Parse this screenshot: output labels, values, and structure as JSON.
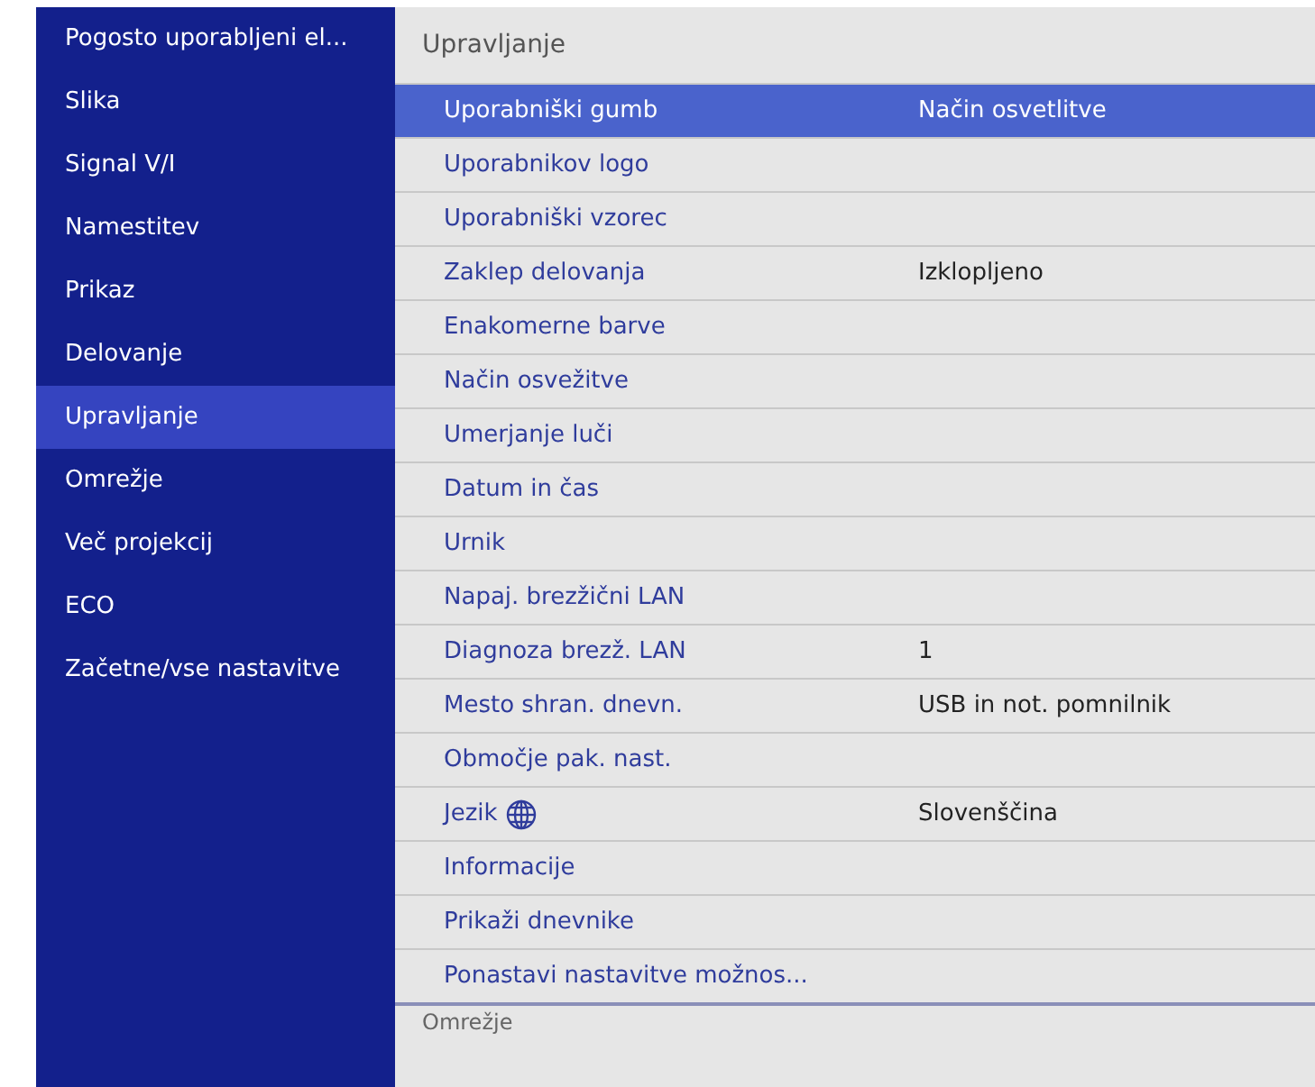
{
  "sidebar": {
    "items": [
      {
        "label": "Pogosto uporabljeni el...",
        "selected": false
      },
      {
        "label": "Slika",
        "selected": false
      },
      {
        "label": "Signal V/I",
        "selected": false
      },
      {
        "label": "Namestitev",
        "selected": false
      },
      {
        "label": "Prikaz",
        "selected": false
      },
      {
        "label": "Delovanje",
        "selected": false
      },
      {
        "label": "Upravljanje",
        "selected": true
      },
      {
        "label": "Omrežje",
        "selected": false
      },
      {
        "label": "Več projekcij",
        "selected": false
      },
      {
        "label": "ECO",
        "selected": false
      },
      {
        "label": "Začetne/vse nastavitve",
        "selected": false
      }
    ]
  },
  "panel": {
    "title": "Upravljanje",
    "rows": [
      {
        "label": "Uporabniški gumb",
        "value": "Način osvetlitve",
        "selected": true
      },
      {
        "label": "Uporabnikov logo",
        "selected": false
      },
      {
        "label": "Uporabniški vzorec",
        "selected": false
      },
      {
        "label": "Zaklep delovanja",
        "value": "Izklopljeno",
        "selected": false
      },
      {
        "label": "Enakomerne barve",
        "selected": false
      },
      {
        "label": "Način osvežitve",
        "selected": false
      },
      {
        "label": "Umerjanje luči",
        "selected": false
      },
      {
        "label": "Datum in čas",
        "selected": false
      },
      {
        "label": "Urnik",
        "selected": false
      },
      {
        "label": "Napaj. brezžični LAN",
        "selected": false
      },
      {
        "label": "Diagnoza brezž. LAN",
        "value": "1",
        "selected": false
      },
      {
        "label": "Mesto shran. dnevn.",
        "value": "USB in not. pomnilnik",
        "selected": false
      },
      {
        "label": "Območje pak. nast.",
        "selected": false
      },
      {
        "label": "Jezik",
        "value": "Slovenščina",
        "globe_icon": true,
        "selected": false
      },
      {
        "label": "Informacije",
        "selected": false
      },
      {
        "label": "Prikaži dnevnike",
        "selected": false
      },
      {
        "label": "Ponastavi nastavitve možnos...",
        "selected": false
      }
    ],
    "next_section": "Omrežje"
  }
}
